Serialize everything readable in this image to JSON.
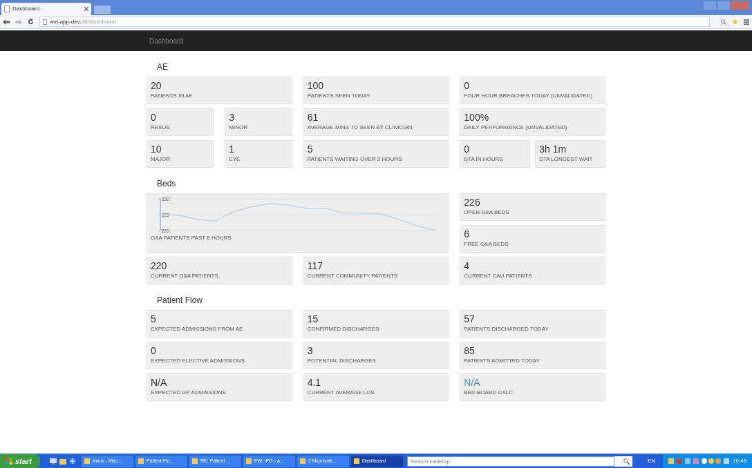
{
  "browser": {
    "tab_title": "Dashboard",
    "url_host": "wvt-app-dev",
    "url_path": ":88/Dashboard"
  },
  "navbar": {
    "brand": "Dashboard"
  },
  "sections": [
    {
      "title": "AE",
      "kind": "grid",
      "rows": [
        [
          [
            {
              "value": "20",
              "label": "PATIENTS IN AE",
              "link": false
            }
          ],
          [
            {
              "value": "100",
              "label": "PATIENTS SEEN TODAY",
              "link": false
            }
          ],
          [
            {
              "value": "0",
              "label": "FOUR HOUR BREACHES TODAY (UNVALIDATED)",
              "link": false
            }
          ]
        ],
        [
          [
            {
              "value": "0",
              "label": "RESUS",
              "link": false
            },
            {
              "value": "3",
              "label": "MINOR",
              "link": false
            }
          ],
          [
            {
              "value": "61",
              "label": "AVERAGE MINS TO SEEN BY CLINICIAN",
              "link": false
            }
          ],
          [
            {
              "value": "100%",
              "label": "DAILY PERFORMANCE (UNVALIDATED)",
              "link": false
            }
          ]
        ],
        [
          [
            {
              "value": "10",
              "label": "MAJOR",
              "link": false
            },
            {
              "value": "1",
              "label": "EYE",
              "link": false
            }
          ],
          [
            {
              "value": "5",
              "label": "PATIENTS WAITING OVER 2 HOURS",
              "link": false
            }
          ],
          [
            {
              "value": "0",
              "label": "DTA IN HOURS",
              "link": false
            },
            {
              "value": "3h 1m",
              "label": "DTA LONGEST WAIT",
              "link": false
            }
          ]
        ]
      ]
    },
    {
      "title": "Beds",
      "kind": "beds",
      "chart": {
        "label": "G&A PATIENTS PAST 8 HOURS",
        "chart_data": {
          "type": "line",
          "values": [
            225,
            224.8,
            223.5,
            223,
            226,
            227.5,
            228.5,
            228,
            227,
            227,
            225.5,
            225.5,
            225.3,
            223.5,
            221.5,
            220
          ],
          "ylim": [
            220,
            230
          ],
          "yticks": [
            220,
            225,
            230
          ]
        }
      },
      "side_cards": [
        {
          "value": "226",
          "label": "OPEN G&A BEDS",
          "link": false
        },
        {
          "value": "6",
          "label": "FREE G&A BEDS",
          "link": false
        }
      ],
      "rows": [
        [
          [
            {
              "value": "220",
              "label": "CURRENT G&A PATIENTS",
              "link": false
            }
          ],
          [
            {
              "value": "117",
              "label": "CURRENT COMMUNITY PATIENTS",
              "link": false
            }
          ],
          [
            {
              "value": "4",
              "label": "CURRENT CAU PATIENTS",
              "link": false
            }
          ]
        ]
      ]
    },
    {
      "title": "Patient Flow",
      "kind": "grid",
      "rows": [
        [
          [
            {
              "value": "5",
              "label": "EXPECTED ADMISSIONS FROM AE",
              "link": false
            }
          ],
          [
            {
              "value": "15",
              "label": "CONFIRMED DISCHARGES",
              "link": false
            }
          ],
          [
            {
              "value": "57",
              "label": "PATIENTS DISCHARGED TODAY",
              "link": false
            }
          ]
        ],
        [
          [
            {
              "value": "0",
              "label": "EXPECTED ELECTIVE ADMISSIONS",
              "link": false
            }
          ],
          [
            {
              "value": "3",
              "label": "POTENTIAL DISCHARGES",
              "link": false
            }
          ],
          [
            {
              "value": "85",
              "label": "PATIENTS ADMITTED TODAY",
              "link": false
            }
          ]
        ],
        [
          [
            {
              "value": "N/A",
              "label": "EXPECTED GP ADMISSIONS",
              "link": false
            }
          ],
          [
            {
              "value": "4.1",
              "label": "CURRENT AVERAGE LOS",
              "link": false
            }
          ],
          [
            {
              "value": "N/A",
              "label": "BED BOARD CALC",
              "link": true
            }
          ]
        ]
      ]
    }
  ],
  "taskbar": {
    "start": "start",
    "tasks": [
      {
        "label": "Inbox - Micr...",
        "selected": false
      },
      {
        "label": "Patient Flo...",
        "selected": false
      },
      {
        "label": "RE: Patient ...",
        "selected": false
      },
      {
        "label": "FW: IPG - A...",
        "selected": false
      },
      {
        "label": "2 Microsoft...",
        "selected": false
      },
      {
        "label": "Dashboard",
        "selected": true
      }
    ],
    "search_placeholder": "Search Desktop",
    "language": "EN",
    "clock": "16:45"
  }
}
